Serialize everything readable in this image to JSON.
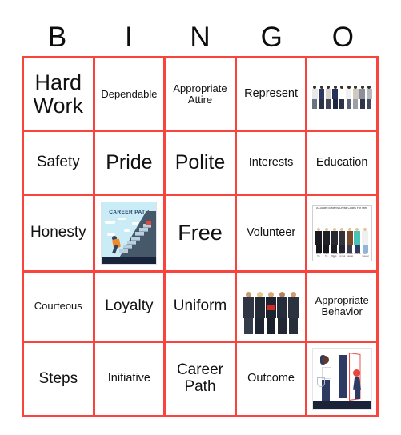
{
  "card": {
    "header_letters": [
      "B",
      "I",
      "N",
      "G",
      "O"
    ],
    "border_color": "#f8443c",
    "text_color": "#111111",
    "background": "#ffffff"
  },
  "rows": [
    {
      "cells": [
        {
          "type": "text",
          "label": "Hard Work",
          "size": "xl"
        },
        {
          "type": "text",
          "label": "Dependable",
          "size": "xs"
        },
        {
          "type": "text",
          "label": "Appropriate Attire",
          "size": "xs"
        },
        {
          "type": "text",
          "label": "Represent",
          "size": "sm"
        },
        {
          "type": "image",
          "label": "",
          "image_name": "row-of-standing-people-photo"
        }
      ]
    },
    {
      "cells": [
        {
          "type": "text",
          "label": "Safety",
          "size": "md"
        },
        {
          "type": "text",
          "label": "Pride",
          "size": "lg"
        },
        {
          "type": "text",
          "label": "Polite",
          "size": "lg"
        },
        {
          "type": "text",
          "label": "Interests",
          "size": "sm"
        },
        {
          "type": "text",
          "label": "Education",
          "size": "sm"
        }
      ]
    },
    {
      "cells": [
        {
          "type": "text",
          "label": "Honesty",
          "size": "md"
        },
        {
          "type": "image",
          "label": "",
          "image_name": "career-path-stairs-illustration"
        },
        {
          "type": "text",
          "label": "Free",
          "size": "xl"
        },
        {
          "type": "text",
          "label": "Volunteer",
          "size": "sm"
        },
        {
          "type": "image",
          "label": "",
          "image_name": "mens-dress-code-guide-chart"
        }
      ]
    },
    {
      "cells": [
        {
          "type": "text",
          "label": "Courteous",
          "size": "xs"
        },
        {
          "type": "text",
          "label": "Loyalty",
          "size": "md"
        },
        {
          "type": "text",
          "label": "Uniform",
          "size": "md"
        },
        {
          "type": "image",
          "label": "",
          "image_name": "business-team-group-photo"
        },
        {
          "type": "text",
          "label": "Appropriate Behavior",
          "size": "xs"
        }
      ]
    },
    {
      "cells": [
        {
          "type": "text",
          "label": "Steps",
          "size": "md"
        },
        {
          "type": "text",
          "label": "Initiative",
          "size": "sm"
        },
        {
          "type": "text",
          "label": "Career Path",
          "size": "md"
        },
        {
          "type": "text",
          "label": "Outcome",
          "size": "sm"
        },
        {
          "type": "image",
          "label": "",
          "image_name": "woman-and-girl-holding-door-illustration"
        }
      ]
    }
  ],
  "images": {
    "career_path": {
      "title": "CAREER PATH",
      "sky_color": "#c9ecf6",
      "hill_color": "#46596b",
      "stair_color": "#b9cfdd",
      "runner_shirt_color": "#f08a2a",
      "flag_color": "#e8453c"
    },
    "dress_code": {
      "title": "A Guide To Men's Dress Codes For Men",
      "captions": [
        "White Tie",
        "Black Tie",
        "Creative Black Tie",
        "Semi-Formal",
        "Business Casual",
        "Casual",
        "Ultra Casual"
      ]
    },
    "door_scene": {
      "panel_color": "#2d3a63",
      "door_outline_color": "#e8453c",
      "footer_color": "#1b2338"
    }
  }
}
